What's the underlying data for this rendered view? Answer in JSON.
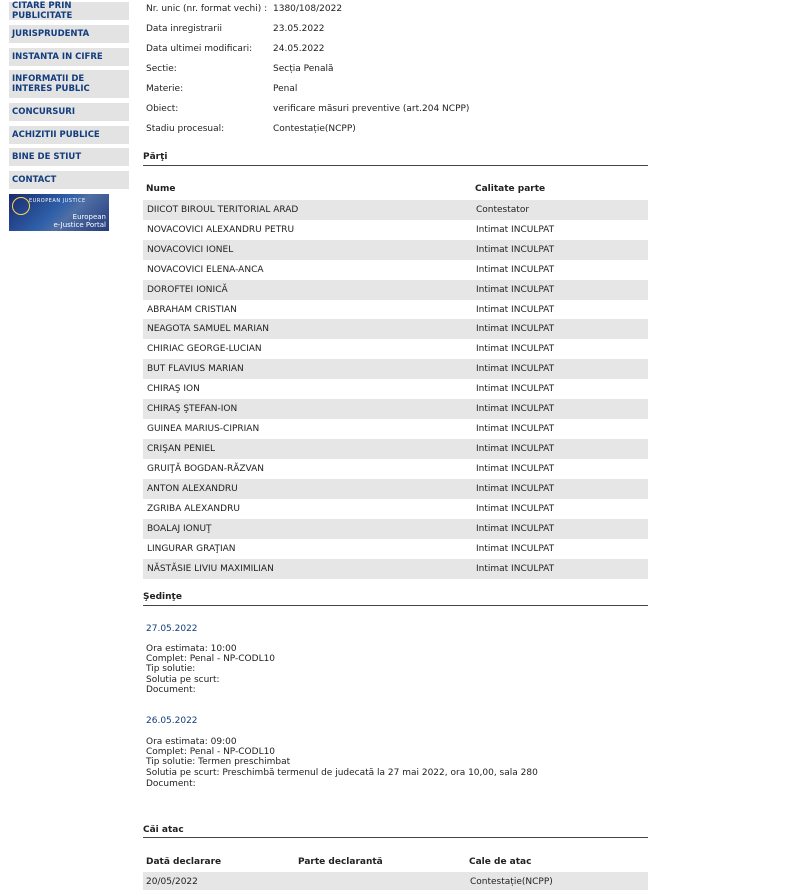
{
  "sidebar": {
    "items": [
      {
        "label": "CITARE PRIN PUBLICITATE"
      },
      {
        "label": "JURISPRUDENTA"
      },
      {
        "label": "INSTANTA IN CIFRE"
      },
      {
        "label": "INFORMATII DE INTERES PUBLIC"
      },
      {
        "label": "CONCURSURI"
      },
      {
        "label": "ACHIZITII PUBLICE"
      },
      {
        "label": "BINE DE STIUT"
      },
      {
        "label": "CONTACT"
      }
    ],
    "banner": {
      "top": "EUROPEAN JUSTICE",
      "line1": "European",
      "line2": "e-Justice Portal"
    }
  },
  "info": [
    {
      "label": "Nr. unic (nr. format vechi) :",
      "value": "1380/108/2022"
    },
    {
      "label": "Data inregistrarii",
      "value": "23.05.2022"
    },
    {
      "label": "Data ultimei modificari:",
      "value": "24.05.2022"
    },
    {
      "label": "Sectie:",
      "value": "Secția Penală"
    },
    {
      "label": "Materie:",
      "value": "Penal"
    },
    {
      "label": "Obiect:",
      "value": "verificare măsuri preventive (art.204 NCPP)"
    },
    {
      "label": "Stadiu procesual:",
      "value": "Contestație(NCPP)"
    }
  ],
  "parti": {
    "title": "Părţi",
    "col_name": "Nume",
    "col_role": "Calitate parte",
    "rows": [
      {
        "name": "DIICOT BIROUL TERITORIAL ARAD",
        "role": "Contestator"
      },
      {
        "name": "NOVACOVICI ALEXANDRU PETRU",
        "role": "Intimat INCULPAT"
      },
      {
        "name": "NOVACOVICI IONEL",
        "role": "Intimat INCULPAT"
      },
      {
        "name": "NOVACOVICI ELENA-ANCA",
        "role": "Intimat INCULPAT"
      },
      {
        "name": "DOROFTEI IONICĂ",
        "role": "Intimat INCULPAT"
      },
      {
        "name": "ABRAHAM CRISTIAN",
        "role": "Intimat INCULPAT"
      },
      {
        "name": "NEAGOTA SAMUEL MARIAN",
        "role": "Intimat INCULPAT"
      },
      {
        "name": "CHIRIAC GEORGE-LUCIAN",
        "role": "Intimat INCULPAT"
      },
      {
        "name": "BUT FLAVIUS MARIAN",
        "role": "Intimat INCULPAT"
      },
      {
        "name": "CHIRAŞ ION",
        "role": "Intimat INCULPAT"
      },
      {
        "name": "CHIRAŞ ŞTEFAN-ION",
        "role": "Intimat INCULPAT"
      },
      {
        "name": "GUINEA MARIUS-CIPRIAN",
        "role": "Intimat INCULPAT"
      },
      {
        "name": "CRIŞAN PENIEL",
        "role": "Intimat INCULPAT"
      },
      {
        "name": "GRUIŢĂ BOGDAN-RĂZVAN",
        "role": "Intimat INCULPAT"
      },
      {
        "name": "ANTON ALEXANDRU",
        "role": "Intimat INCULPAT"
      },
      {
        "name": "ZGRIBA ALEXANDRU",
        "role": "Intimat INCULPAT"
      },
      {
        "name": "BOALAJ IONUŢ",
        "role": "Intimat INCULPAT"
      },
      {
        "name": "LINGURAR GRAŢIAN",
        "role": "Intimat INCULPAT"
      },
      {
        "name": "NĂSTĂSIE LIVIU MAXIMILIAN",
        "role": "Intimat INCULPAT"
      }
    ]
  },
  "sedinte": {
    "title": "Şedinţe",
    "sessions": [
      {
        "date": "27.05.2022",
        "lines": [
          "Ora estimata: 10:00",
          "Complet: Penal - NP-CODL10",
          "Tip solutie:",
          "Solutia pe scurt:",
          "Document:"
        ]
      },
      {
        "date": "26.05.2022",
        "lines": [
          "Ora estimata: 09:00",
          "Complet: Penal - NP-CODL10",
          "Tip solutie: Termen preschimbat",
          "Solutia pe scurt: Preschimbă termenul de judecată la 27 mai 2022, ora 10,00, sala 280",
          "Document:"
        ]
      }
    ]
  },
  "cai_atac": {
    "title": "Căi atac",
    "col_date": "Dată declarare",
    "col_party": "Parte declarantă",
    "col_type": "Cale de atac",
    "rows": [
      {
        "date": "20/05/2022",
        "party": "",
        "type": "Contestație(NCPP)"
      }
    ]
  }
}
